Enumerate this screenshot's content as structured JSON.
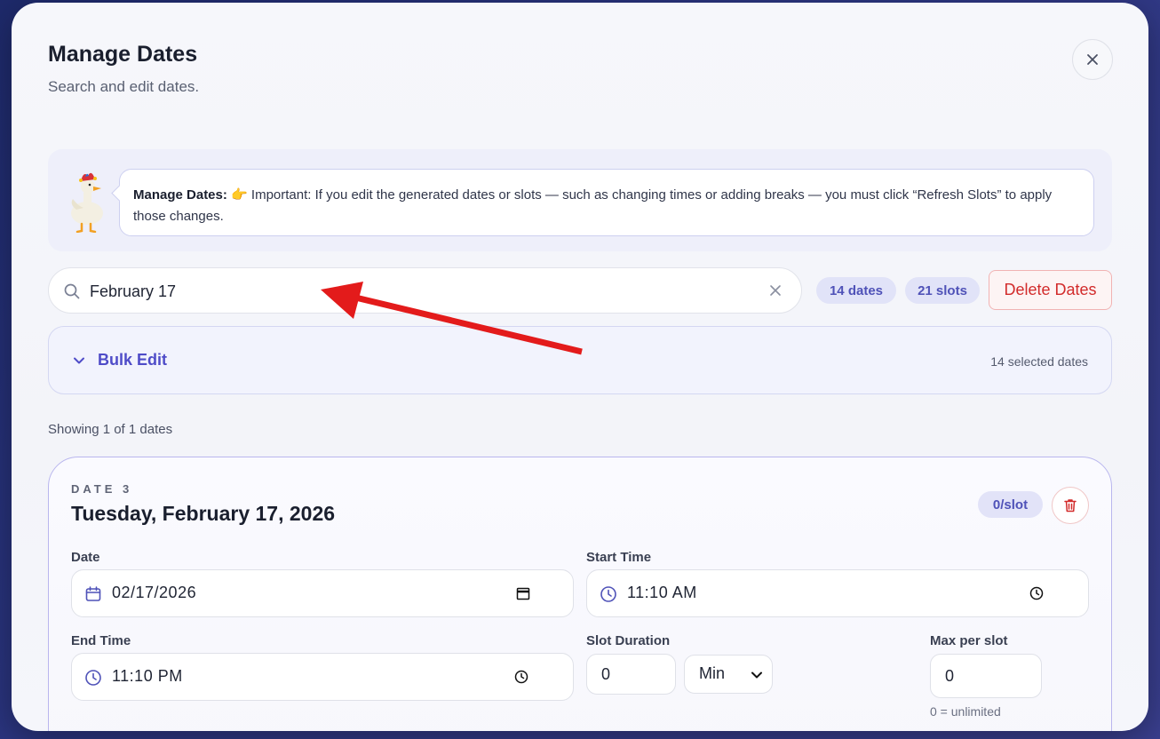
{
  "modal": {
    "title": "Manage Dates",
    "subtitle": "Search and edit dates."
  },
  "info": {
    "heading": "Manage Dates:",
    "emoji": "👉",
    "text": " Important: If you edit the generated dates or slots — such as changing times or adding breaks — you must click “Refresh Slots” to apply those changes."
  },
  "search": {
    "value": "February 17"
  },
  "stats": {
    "dates": "14 dates",
    "slots": "21 slots"
  },
  "actions": {
    "delete_label": "Delete Dates"
  },
  "bulk_edit": {
    "label": "Bulk Edit",
    "selected": "14 selected dates"
  },
  "results": {
    "showing": "Showing 1 of 1 dates"
  },
  "date_card": {
    "kicker": "DATE 3",
    "title": "Tuesday, February 17, 2026",
    "slot_badge": "0/slot",
    "date_label": "Date",
    "date_value": "02/17/2026",
    "start_label": "Start Time",
    "start_value": "11:10 AM",
    "end_label": "End Time",
    "end_value": "11:10 PM",
    "duration_label": "Slot Duration",
    "duration_value": "0",
    "duration_unit": "Min",
    "max_label": "Max per slot",
    "max_value": "0",
    "max_hint": "0 = unlimited"
  },
  "colors": {
    "accent": "#4f52b8",
    "danger": "#d22b2b",
    "arrow": "#e31b1b"
  }
}
